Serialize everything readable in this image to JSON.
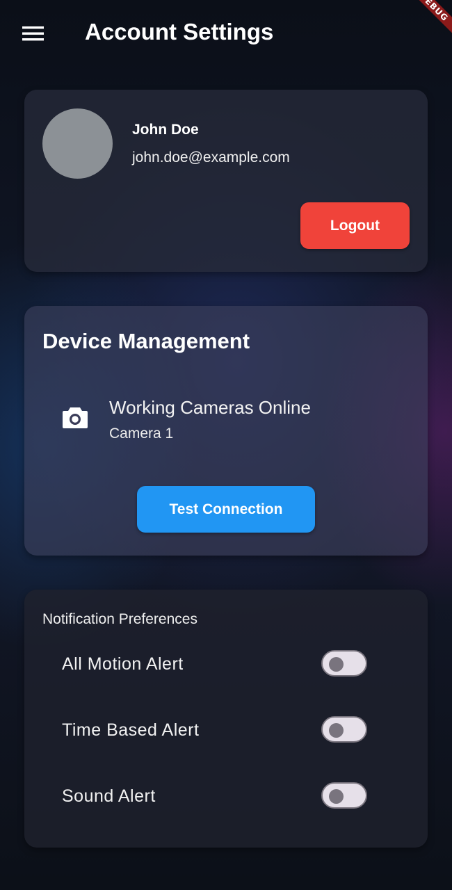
{
  "app_bar": {
    "title": "Account Settings",
    "menu_icon": "hamburger-menu-icon"
  },
  "debug_banner": "DEBUG",
  "profile": {
    "name": "John Doe",
    "email": "john.doe@example.com",
    "avatar_color": "#8c9196",
    "logout_label": "Logout",
    "logout_color": "#f0433a"
  },
  "device_management": {
    "title": "Device Management",
    "camera_icon": "camera-icon",
    "camera_title": "Working Cameras Online",
    "camera_subtitle": "Camera 1",
    "test_button_label": "Test Connection",
    "test_button_color": "#2196f3"
  },
  "notifications": {
    "title": "Notification Preferences",
    "items": [
      {
        "label": "All Motion Alert",
        "enabled": false
      },
      {
        "label": "Time Based Alert",
        "enabled": false
      },
      {
        "label": "Sound Alert",
        "enabled": false
      }
    ]
  }
}
